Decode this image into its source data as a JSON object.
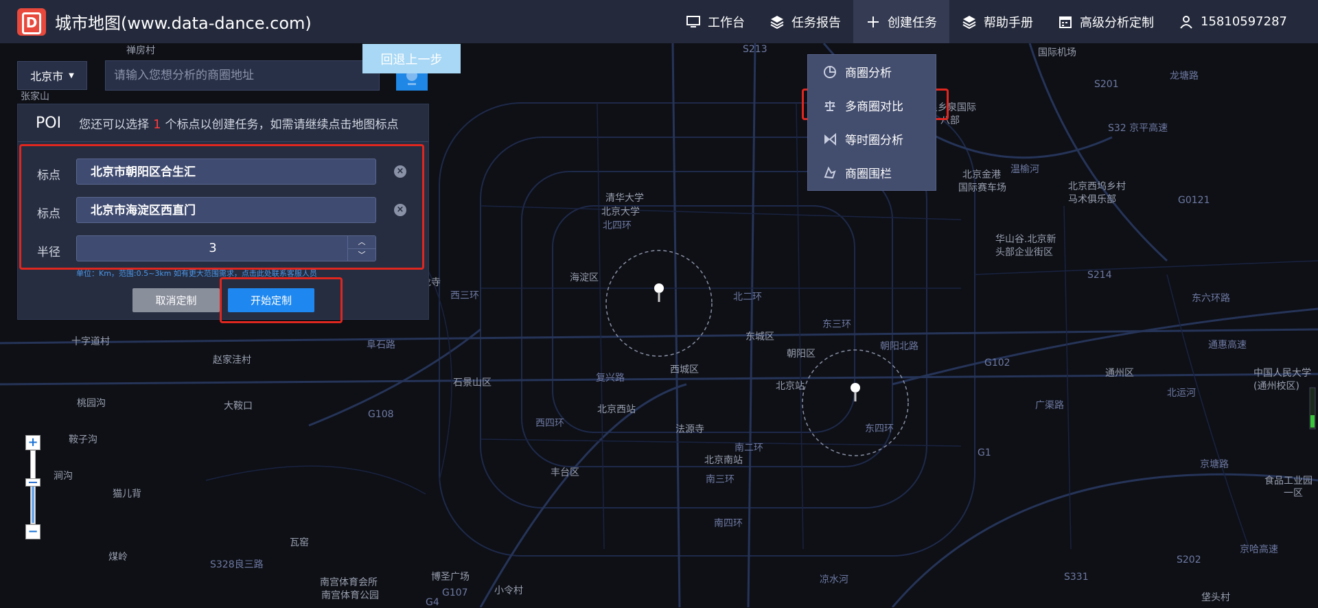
{
  "app": {
    "title": "城市地图(www.data-dance.com)",
    "logo_letter": "D"
  },
  "nav": [
    {
      "label": "工作台",
      "icon": "monitor-icon"
    },
    {
      "label": "任务报告",
      "icon": "layers-icon"
    },
    {
      "label": "创建任务",
      "icon": "plus-icon",
      "active": true
    },
    {
      "label": "帮助手册",
      "icon": "layers-icon"
    },
    {
      "label": "高级分析定制",
      "icon": "calendar-icon"
    },
    {
      "label": "15810597287",
      "icon": "user-icon"
    }
  ],
  "dropdown": [
    {
      "label": "商圈分析",
      "icon": "pie-chart-icon"
    },
    {
      "label": "多商圈对比",
      "icon": "scale-icon"
    },
    {
      "label": "等时圈分析",
      "icon": "hourglass-icon"
    },
    {
      "label": "商圈围栏",
      "icon": "fence-icon"
    }
  ],
  "search": {
    "city": "北京市",
    "placeholder": "请输入您想分析的商圈地址",
    "back_label": "回退上一步"
  },
  "poi": {
    "title": "POI",
    "hint_before": "您还可以选择",
    "hint_count": "1",
    "hint_after": "个标点以创建任务，如需请继续点击地图标点",
    "points": [
      {
        "label": "标点",
        "value": "北京市朝阳区合生汇"
      },
      {
        "label": "标点",
        "value": "北京市海淀区西直门"
      }
    ],
    "radius_label": "半径",
    "radius_value": "3",
    "note": "单位：Km，范围:0.5~3km 如有更大范围需求，点击此处联系客服人员",
    "cancel_label": "取消定制",
    "start_label": "开始定制"
  },
  "zoom": {
    "plus": "+",
    "minus": "−"
  },
  "map_labels": [
    {
      "text": "禅房村"
    },
    {
      "text": "张家山"
    },
    {
      "text": "清华大学"
    },
    {
      "text": "北京大学"
    },
    {
      "text": "北四环"
    },
    {
      "text": "海淀区"
    },
    {
      "text": "北二环"
    },
    {
      "text": "东城区"
    },
    {
      "text": "朝阳区"
    },
    {
      "text": "朝阳北路"
    },
    {
      "text": "西城区"
    },
    {
      "text": "石景山区"
    },
    {
      "text": "阜石路"
    },
    {
      "text": "复兴路"
    },
    {
      "text": "北京站"
    },
    {
      "text": "北京西站"
    },
    {
      "text": "法源寺"
    },
    {
      "text": "北京南站"
    },
    {
      "text": "丰台区"
    },
    {
      "text": "十字道村"
    },
    {
      "text": "赵家洼村"
    },
    {
      "text": "桃园沟"
    },
    {
      "text": "大鞍口"
    },
    {
      "text": "鞍子沟"
    },
    {
      "text": "涧沟"
    },
    {
      "text": "猫儿背"
    },
    {
      "text": "G108"
    },
    {
      "text": "煤岭"
    },
    {
      "text": "瓦窑"
    },
    {
      "text": "S328良三路"
    },
    {
      "text": "南宫体育会所"
    },
    {
      "text": "南宫体育公园"
    },
    {
      "text": "博圣广场"
    },
    {
      "text": "小令村"
    },
    {
      "text": "G107"
    },
    {
      "text": "G4"
    },
    {
      "text": "北京金港"
    },
    {
      "text": "国际赛车场"
    },
    {
      "text": "北京西坞乡村"
    },
    {
      "text": "马术俱乐部"
    },
    {
      "text": "华山谷.北京新"
    },
    {
      "text": "头部企业街区"
    },
    {
      "text": "温榆河"
    },
    {
      "text": "G0121"
    },
    {
      "text": "S214"
    },
    {
      "text": "S213"
    },
    {
      "text": "S201"
    },
    {
      "text": "龙塘路"
    },
    {
      "text": "S32 京平高速"
    },
    {
      "text": "国际机场"
    },
    {
      "text": "G102"
    },
    {
      "text": "通州区"
    },
    {
      "text": "中国人民大学"
    },
    {
      "text": "(通州校区)"
    },
    {
      "text": "北运河"
    },
    {
      "text": "G1"
    },
    {
      "text": "食品工业园"
    },
    {
      "text": "一区"
    },
    {
      "text": "京哈高速"
    },
    {
      "text": "S202"
    },
    {
      "text": "S331"
    },
    {
      "text": "垡头村"
    },
    {
      "text": "凉水河"
    },
    {
      "text": "南四环"
    },
    {
      "text": "南三环"
    },
    {
      "text": "南二环"
    },
    {
      "text": "东四环"
    },
    {
      "text": "东三环"
    },
    {
      "text": "西四环"
    },
    {
      "text": "西三环"
    },
    {
      "text": "广渠路"
    },
    {
      "text": "京塘路"
    },
    {
      "text": "东六环路"
    },
    {
      "text": "通惠高速"
    },
    {
      "text": "良乡泉国际"
    },
    {
      "text": "八部"
    },
    {
      "text": "龙寺"
    }
  ],
  "colors": {
    "accent": "#1e88f0",
    "highlight": "#e0271f",
    "topbar": "#242a3c",
    "panel": "#262d40"
  }
}
